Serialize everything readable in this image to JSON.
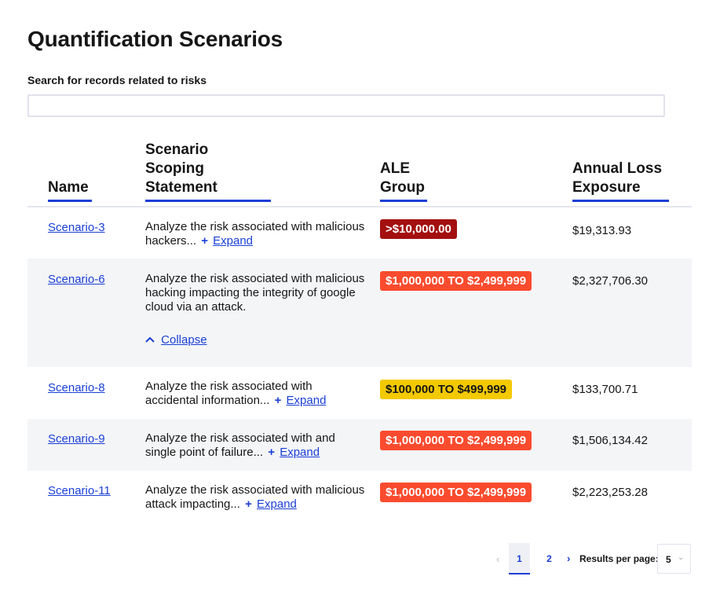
{
  "page": {
    "title": "Quantification Scenarios"
  },
  "search": {
    "label": "Search for records related to risks",
    "value": "",
    "placeholder": ""
  },
  "table": {
    "headers": {
      "name": "Name",
      "scoping_line1": "Scenario",
      "scoping_line2": "Scoping",
      "scoping_line3": "Statement",
      "ale_group_line1": "ALE",
      "ale_group_line2": "Group",
      "annual_line1": "Annual Loss",
      "annual_line2": "Exposure"
    },
    "rows": [
      {
        "name": "Scenario-3",
        "statement": "Analyze the risk associated with malicious hackers...",
        "toggle_symbol": "+",
        "toggle_label": "Expand",
        "ale_group": ">$10,000.00",
        "ale_group_color": "#a40f0f",
        "annual_loss": "$19,313.93"
      },
      {
        "name": "Scenario-6",
        "statement": "Analyze the risk associated with malicious hacking impacting the integrity of google cloud via an attack.",
        "toggle_symbol": "^",
        "toggle_label": "Collapse",
        "ale_group": "$1,000,000 TO $2,499,999",
        "ale_group_color": "#fa4b2e",
        "annual_loss": "$2,327,706.30"
      },
      {
        "name": "Scenario-8",
        "statement": "Analyze the risk associated with accidental information...",
        "toggle_symbol": "+",
        "toggle_label": "Expand",
        "ale_group": "$100,000 TO $499,999",
        "ale_group_color": "#f3c900",
        "annual_loss": "$133,700.71"
      },
      {
        "name": "Scenario-9",
        "statement": "Analyze the risk associated with and single point of failure...",
        "toggle_symbol": "+",
        "toggle_label": "Expand",
        "ale_group": "$1,000,000 TO $2,499,999",
        "ale_group_color": "#fa4b2e",
        "annual_loss": "$1,506,134.42"
      },
      {
        "name": "Scenario-11",
        "statement": "Analyze the risk associated with malicious attack impacting...",
        "toggle_symbol": "+",
        "toggle_label": "Expand",
        "ale_group": "$1,000,000 TO $2,499,999",
        "ale_group_color": "#fa4b2e",
        "annual_loss": "$2,223,253.28"
      }
    ]
  },
  "pagination": {
    "pages": [
      "1",
      "2"
    ],
    "current_page": "1",
    "results_per_page_label": "Results per page:",
    "results_per_page_value": "5",
    "prev_icon": "chevron-left-icon",
    "next_icon": "chevron-right-icon"
  },
  "colors": {
    "accent": "#1a3fd6",
    "row_alt": "#f4f5f7"
  }
}
